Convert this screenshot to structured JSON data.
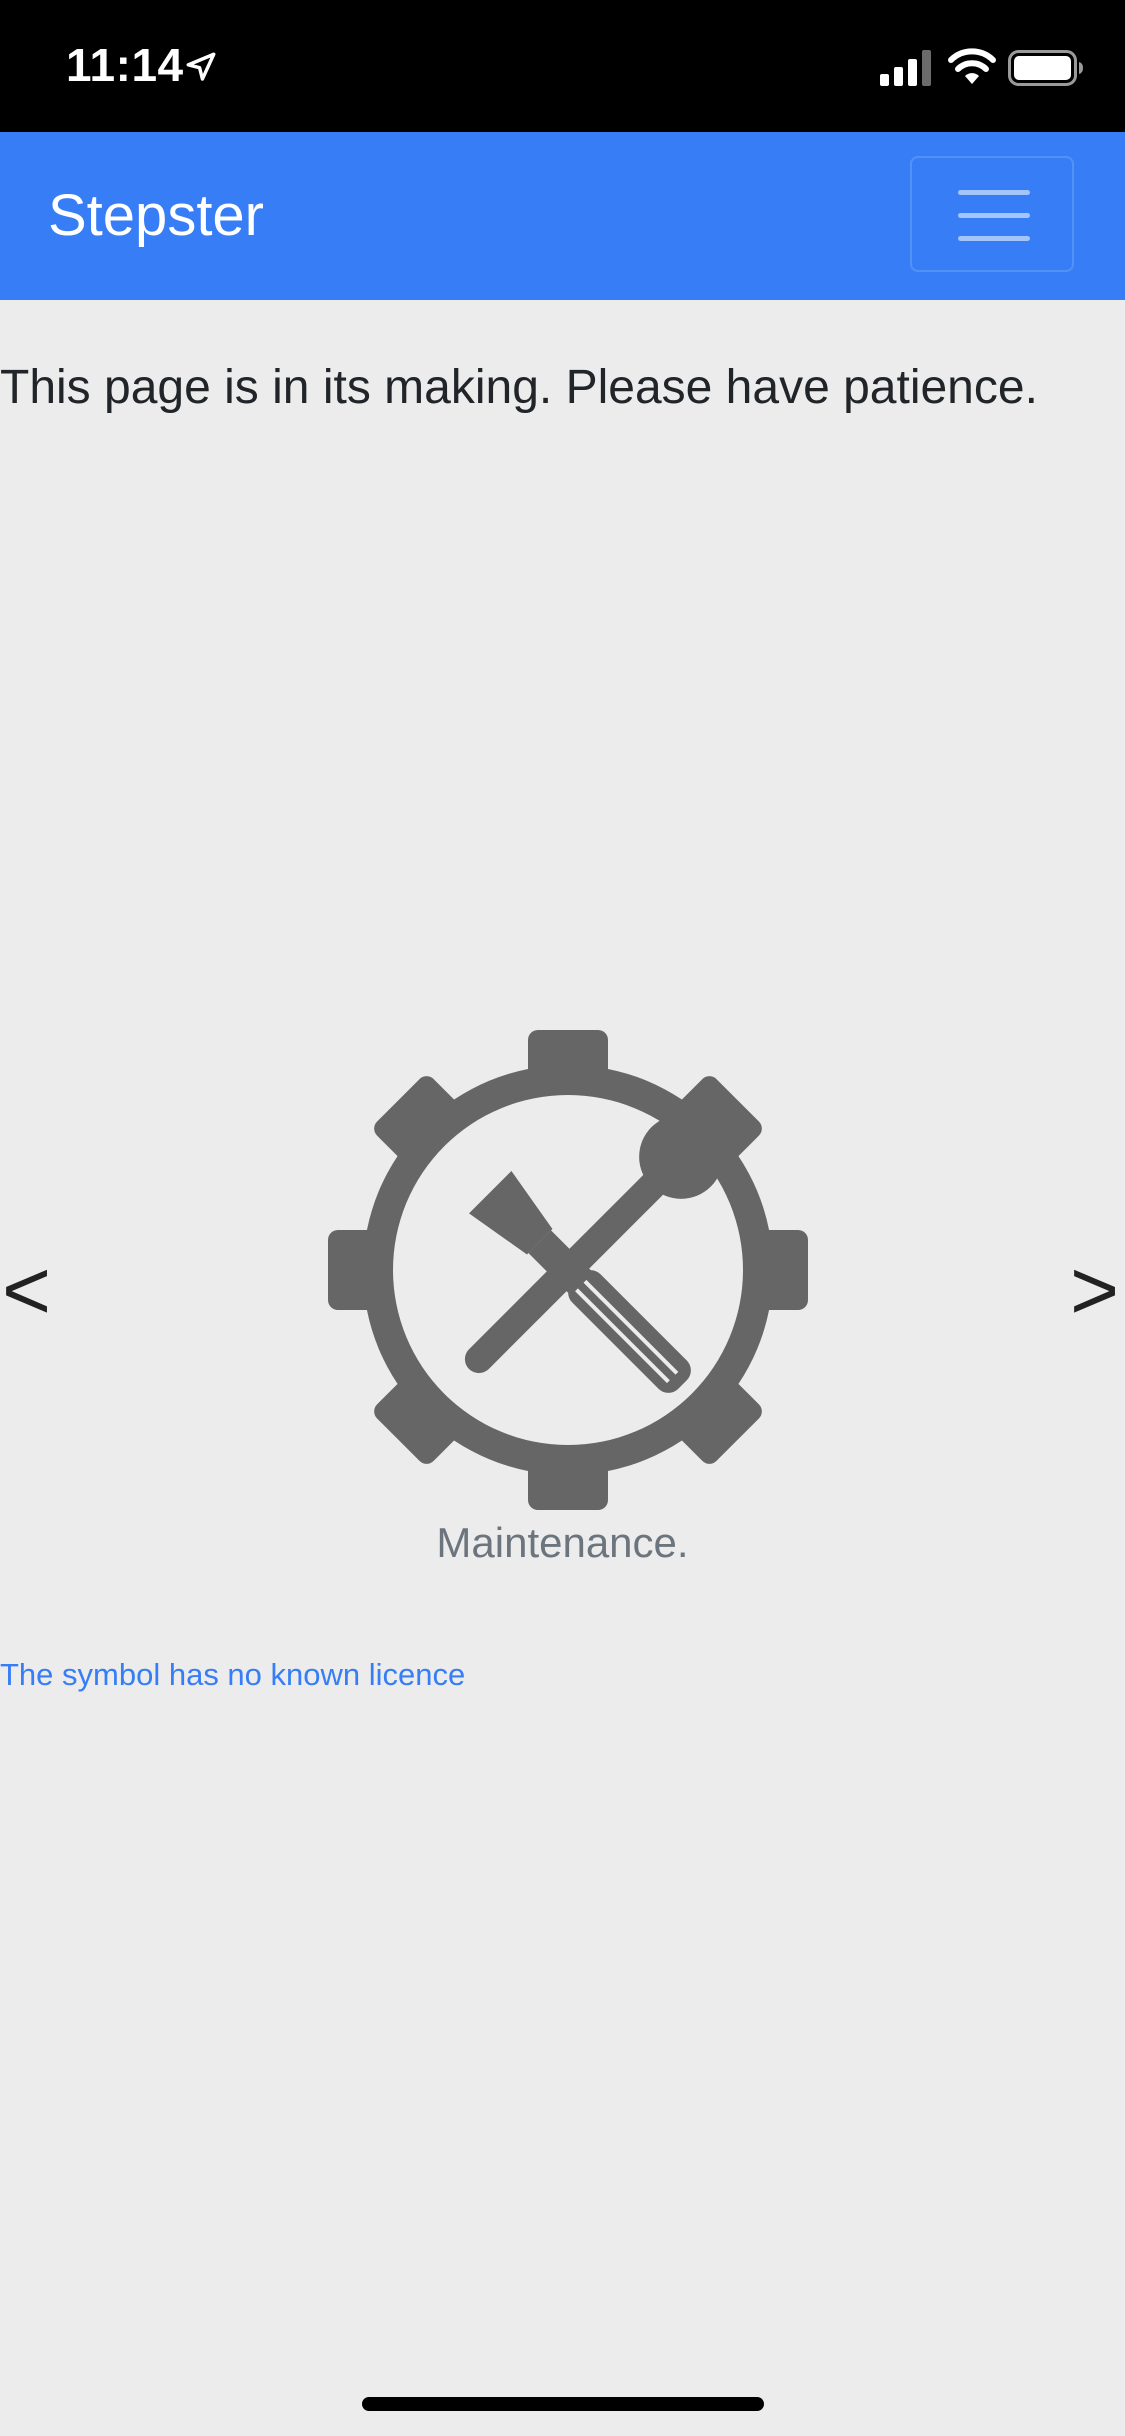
{
  "status_bar": {
    "time": "11:14",
    "icons": [
      "location-arrow-icon",
      "cellular-signal-icon",
      "wifi-icon",
      "battery-icon"
    ]
  },
  "navbar": {
    "brand": "Stepster",
    "toggler_icon": "hamburger-menu-icon",
    "background_color": "#377ef6"
  },
  "main": {
    "notice": "This page is in its making. Please have patience.",
    "carousel": {
      "prev_label": "<",
      "next_label": ">",
      "slide": {
        "icon": "gear-wrench-screwdriver-icon",
        "caption": "Maintenance."
      }
    },
    "licence_link": "The symbol has no known licence"
  },
  "colors": {
    "page_background": "#ececec",
    "symbol": "#666666",
    "link": "#377ef6",
    "caption": "#6c757d"
  }
}
